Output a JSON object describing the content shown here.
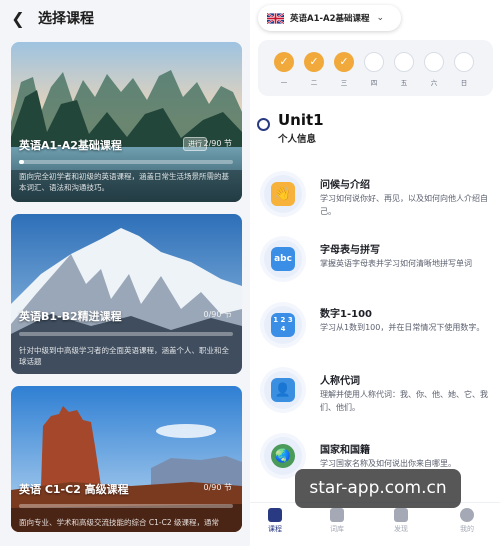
{
  "left": {
    "title": "选择课程",
    "back_icon": "chevron-left-icon",
    "courses": [
      {
        "title": "英语A1-A2基础课程",
        "badge": "进行",
        "count": "2/90 节",
        "progress": 0.022,
        "desc": "面向完全初学者和初级的英语课程，涵盖日常生活场景所需的基本词汇、语法和沟通技巧。"
      },
      {
        "title": "英语B1-B2精进课程",
        "count": "0/90 节",
        "progress": 0,
        "desc": "针对中级到中高级学习者的全面英语课程，涵盖个人、职业和全球话题"
      },
      {
        "title": "英语 C1-C2 高级课程",
        "count": "0/90 节",
        "progress": 0,
        "desc": "面向专业、学术和高级交流技能的综合 C1-C2 级课程，通常"
      }
    ]
  },
  "right": {
    "course_select": {
      "label": "英语A1-A2基础课程",
      "flag_icon": "uk-flag-icon",
      "chevron_icon": "chevron-down-icon"
    },
    "days": [
      {
        "label": "一",
        "done": true
      },
      {
        "label": "二",
        "done": true
      },
      {
        "label": "三",
        "done": true
      },
      {
        "label": "四",
        "done": false
      },
      {
        "label": "五",
        "done": false
      },
      {
        "label": "六",
        "done": false
      },
      {
        "label": "日",
        "done": false
      }
    ],
    "check_glyph": "✓",
    "unit": {
      "title": "Unit1",
      "subtitle": "个人信息"
    },
    "lessons": [
      {
        "title": "问候与介绍",
        "desc": "学习如何说你好、再见，以及如何向他人介绍自己。",
        "icon": "waving-hand-icon",
        "glyph": "👋",
        "color": "#f6b23b"
      },
      {
        "title": "字母表与拼写",
        "desc": "掌握英语字母表并学习如何清晰地拼写单词",
        "icon": "abc-icon",
        "glyph": "abc",
        "color": "#3a8ee6"
      },
      {
        "title": "数字1-100",
        "desc": "学习从1数到100，并在日常情况下使用数字。",
        "icon": "numbers-1234-icon",
        "glyph": "1 2 3 4",
        "color": "#3a8ee6"
      },
      {
        "title": "人称代词",
        "desc": "理解并使用人称代词：我、你、他、她、它、我们、他们。",
        "icon": "person-icon",
        "glyph": "👤",
        "color": "#3b8fe0"
      },
      {
        "title": "国家和国籍",
        "desc": "学习国家名称及如何说出你来自哪里。",
        "icon": "globe-icon",
        "glyph": "🌏",
        "color": "#4a9a5a"
      }
    ],
    "tabs": [
      {
        "label": "课程",
        "icon": "course-icon",
        "active": true
      },
      {
        "label": "词库",
        "icon": "vocab-icon",
        "active": false
      },
      {
        "label": "发现",
        "icon": "discover-icon",
        "active": false
      },
      {
        "label": "我的",
        "icon": "profile-icon",
        "active": false
      }
    ]
  },
  "watermark": "star-app.com.cn",
  "colors": {
    "accent": "#f0a93a",
    "primary": "#2a3a82",
    "tab_active": "#2a3a82",
    "tab_inactive": "#a4a9b5"
  }
}
